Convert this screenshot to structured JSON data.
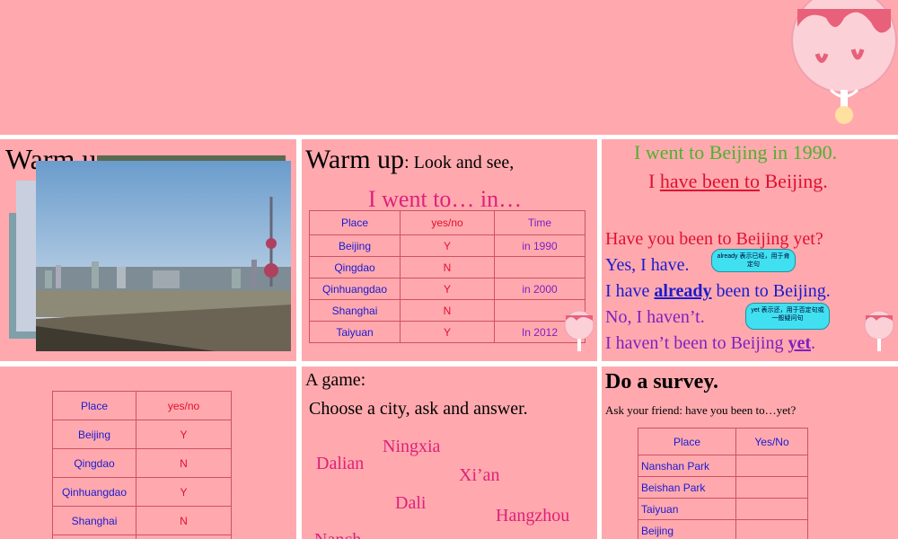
{
  "slide2": {
    "title": "Warm u"
  },
  "slide3": {
    "title_main": "Warm up",
    "title_sub": ": Look and see,",
    "prompt": "I went to… in…",
    "table": {
      "headers": [
        "Place",
        "yes/no",
        "Time"
      ],
      "rows": [
        [
          "Beijing",
          "Y",
          "in 1990"
        ],
        [
          "Qingdao",
          "N",
          ""
        ],
        [
          "Qinhuangdao",
          "Y",
          "in 2000"
        ],
        [
          "Shanghai",
          "N",
          ""
        ],
        [
          "Taiyuan",
          "Y",
          "In 2012"
        ]
      ]
    }
  },
  "slide4": {
    "line1": "I went to Beijing in 1990.",
    "line2_pre": "I ",
    "line2_u": "have been to",
    "line2_post": " Beijing.",
    "q": "Have you been to Beijing yet?",
    "a1": "Yes, I have.",
    "a2_pre": "I have ",
    "a2_kw": "already",
    "a2_post": " been to Beijing.",
    "a3": "No, I haven’t.",
    "a4_pre": "I haven’t been to Beijing ",
    "a4_kw": "yet",
    "a4_post": ".",
    "note_already": "already 表示已经，用于肯定句",
    "note_yet": "yet 表示还，用于否定句或一般疑问句"
  },
  "slide5": {
    "table": {
      "headers": [
        "Place",
        "yes/no"
      ],
      "rows": [
        [
          "Beijing",
          "Y"
        ],
        [
          "Qingdao",
          "N"
        ],
        [
          "Qinhuangdao",
          "Y"
        ],
        [
          "Shanghai",
          "N"
        ],
        [
          "",
          ""
        ]
      ]
    }
  },
  "slide6": {
    "title": "A game:",
    "instruction": "Choose a city, ask and answer.",
    "cities": [
      "Ningxia",
      "Dalian",
      "Xi’an",
      "Dali",
      "Hangzhou",
      "Nanch"
    ]
  },
  "slide7": {
    "title": "Do a survey.",
    "instruction": "Ask your friend: have you been to…yet?",
    "table": {
      "headers": [
        "Place",
        "Yes/No"
      ],
      "rows": [
        [
          "Nanshan Park",
          ""
        ],
        [
          "Beishan Park",
          ""
        ],
        [
          "Taiyuan",
          ""
        ],
        [
          "Beijing",
          ""
        ]
      ]
    }
  },
  "colors": {
    "slide_bg": "#ffa9ae",
    "blue_text": "#1a1ad0",
    "red_text": "#e01030",
    "magenta_text": "#e0207a",
    "green_text": "#50b030",
    "purple_text": "#8020c0"
  }
}
